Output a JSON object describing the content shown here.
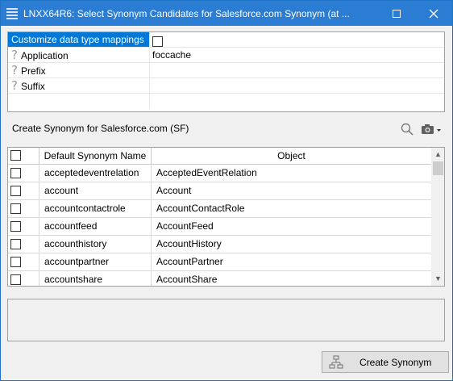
{
  "window": {
    "title": "LNXX64R6: Select Synonym Candidates for Salesforce.com Synonym (at ..."
  },
  "properties": [
    {
      "label": "Customize data type mappings",
      "value": "",
      "type": "checkbox",
      "checked": false,
      "selected": true
    },
    {
      "label": "Application",
      "value": "foccache",
      "type": "text",
      "help": true
    },
    {
      "label": "Prefix",
      "value": "",
      "type": "text",
      "help": true
    },
    {
      "label": "Suffix",
      "value": "",
      "type": "text",
      "help": true
    }
  ],
  "section": {
    "label": "Create Synonym for Salesforce.com (SF)"
  },
  "table": {
    "columns": [
      "Default Synonym Name",
      "Object"
    ],
    "rows": [
      {
        "name": "acceptedeventrelation",
        "object": "AcceptedEventRelation",
        "checked": false
      },
      {
        "name": "account",
        "object": "Account",
        "checked": false
      },
      {
        "name": "accountcontactrole",
        "object": "AccountContactRole",
        "checked": false
      },
      {
        "name": "accountfeed",
        "object": "AccountFeed",
        "checked": false
      },
      {
        "name": "accounthistory",
        "object": "AccountHistory",
        "checked": false
      },
      {
        "name": "accountpartner",
        "object": "AccountPartner",
        "checked": false
      },
      {
        "name": "accountshare",
        "object": "AccountShare",
        "checked": false
      }
    ]
  },
  "footer": {
    "create_label": "Create Synonym"
  },
  "colors": {
    "titlebar": "#2b7cd3",
    "selection": "#0078d7"
  }
}
